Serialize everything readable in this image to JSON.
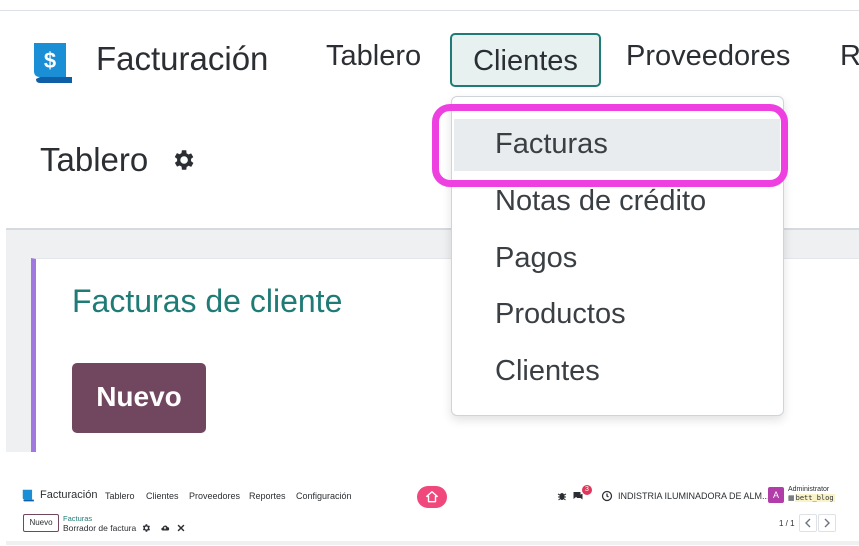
{
  "zoom": {
    "app_name": "Facturación",
    "menu": [
      "Tablero",
      "Clientes",
      "Proveedores",
      "R"
    ],
    "page_title": "Tablero",
    "dropdown_items": [
      "Facturas",
      "Notas de crédito",
      "Pagos",
      "Productos",
      "Clientes"
    ],
    "card_title": "Facturas de cliente",
    "new_button": "Nuevo"
  },
  "mini": {
    "app_name": "Facturación",
    "menu": [
      "Tablero",
      "Clientes",
      "Proveedores",
      "Reportes",
      "Configuración"
    ],
    "badge_count": "3",
    "company": "INDISTRIA ILUMINADORA DE ALM...",
    "avatar_letter": "A",
    "user": "Administrator",
    "database": "bett_blog",
    "new_button": "Nuevo",
    "breadcrumb_parent": "Facturas",
    "breadcrumb_current": "Borrador de factura",
    "pager": "1 / 1"
  },
  "colors": {
    "accent_teal": "#1f7b76",
    "primary_button": "#71475f",
    "highlight_magenta": "#ee3fe0",
    "card_border": "#a078e0",
    "home_button": "#f0487d"
  },
  "icons": [
    "app-logo-icon",
    "gear-icon",
    "home-icon",
    "bug-icon",
    "chat-icon",
    "clock-icon",
    "cloud-save-icon",
    "discard-icon",
    "chevron-left-icon",
    "chevron-right-icon"
  ]
}
